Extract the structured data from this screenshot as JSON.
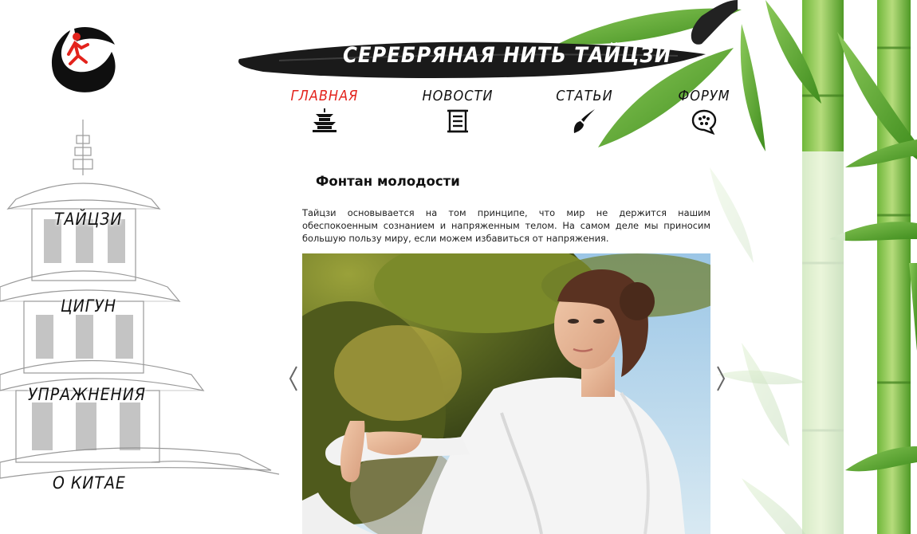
{
  "site": {
    "title": "СЕРЕБРЯНАЯ НИТЬ ТАЙЦЗИ"
  },
  "logo": {
    "text_top": "СЕРЕБРЯНАЯ НИТЬ",
    "text_bottom": "ТАЙЦЗИ"
  },
  "top_nav": {
    "items": [
      {
        "label": "ГЛАВНАЯ",
        "icon": "pagoda-icon",
        "active": true
      },
      {
        "label": "НОВОСТИ",
        "icon": "scroll-icon",
        "active": false
      },
      {
        "label": "СТАТЬИ",
        "icon": "brush-icon",
        "active": false
      },
      {
        "label": "ФОРУМ",
        "icon": "speech-bubble-icon",
        "active": false
      }
    ]
  },
  "side_menu": {
    "items": [
      {
        "label": "ТАЙЦЗИ"
      },
      {
        "label": "ЦИГУН"
      },
      {
        "label": "УПРАЖНЕНИЯ"
      },
      {
        "label": "О КИТАЕ"
      }
    ]
  },
  "article": {
    "title": "Фонтан молодости",
    "text": "Тайцзи основывается на том принципе, что мир не держится нашим обеспокоенным сознанием и напряженным телом. На самом деле мы приносим большую пользу миру, если можем избавиться от напряжения."
  },
  "colors": {
    "accent": "#e3231c",
    "text": "#111111",
    "bamboo": "#5fae2c"
  }
}
